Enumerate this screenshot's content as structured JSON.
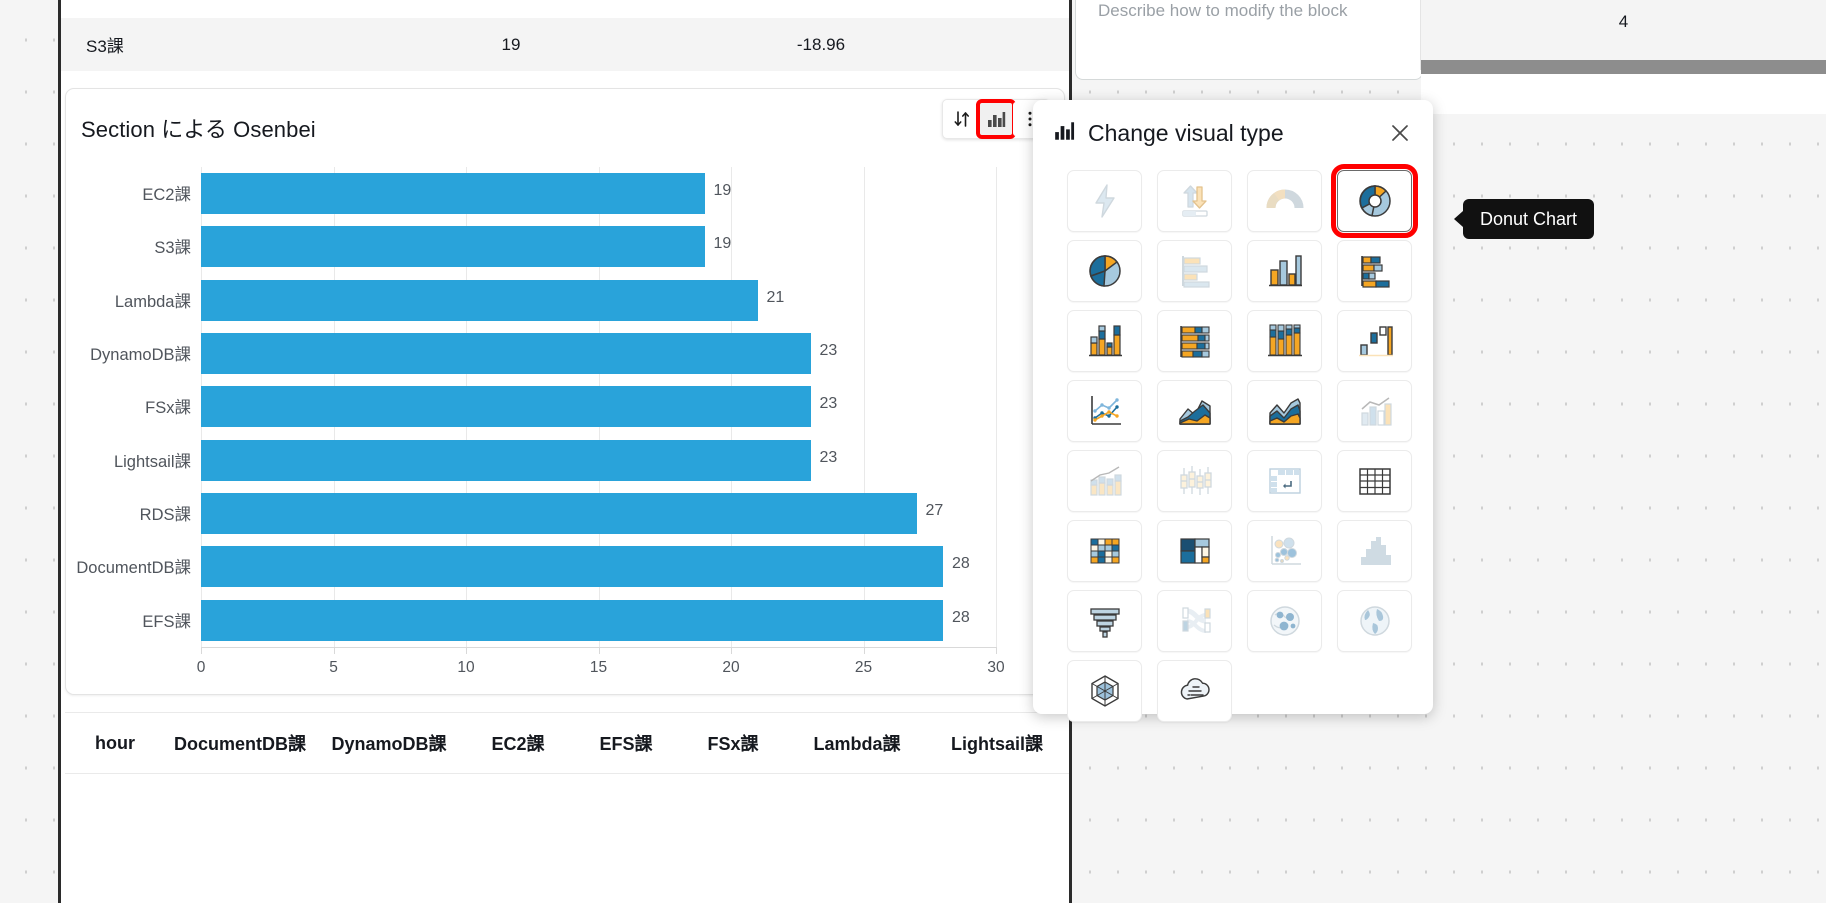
{
  "top_table": {
    "row": {
      "section": "S3課",
      "count": "19",
      "delta": "-18.96"
    }
  },
  "chart_card": {
    "title": "Section による Osenbei",
    "toolbar": {
      "sort_icon": "sort-icon",
      "visual_type_icon": "bar-chart-icon",
      "more_icon": "kebab-menu-icon"
    }
  },
  "chart_data": {
    "type": "bar",
    "orientation": "horizontal",
    "title": "Section による Osenbei",
    "xlabel": "",
    "ylabel": "",
    "categories": [
      "EC2課",
      "S3課",
      "Lambda課",
      "DynamoDB課",
      "FSx課",
      "Lightsail課",
      "RDS課",
      "DocumentDB課",
      "EFS課"
    ],
    "values": [
      19,
      19,
      21,
      23,
      23,
      23,
      27,
      28,
      28
    ],
    "value_labels": [
      "19",
      "19",
      "21",
      "23",
      "23",
      "23",
      "27",
      "28",
      "28"
    ],
    "xlim": [
      0,
      30
    ],
    "xticks": [
      "0",
      "5",
      "10",
      "15",
      "20",
      "25",
      "30"
    ],
    "xtick_values": [
      0,
      5,
      10,
      15,
      20,
      25,
      30
    ],
    "grid": true,
    "legend": false,
    "bar_color": "#29a3da"
  },
  "bottom_table": {
    "headers": [
      "hour",
      "DocumentDB課",
      "DynamoDB課",
      "EC2課",
      "EFS課",
      "FSx課",
      "Lambda課",
      "Lightsail課"
    ]
  },
  "right_panels": {
    "prompt_placeholder": "Describe how to modify the block",
    "metric_value": "4"
  },
  "change_visual_type": {
    "title": "Change visual type",
    "header_icon": "bar-chart-icon",
    "close_icon": "close-icon",
    "selected": "Donut Chart",
    "tooltip": "Donut Chart",
    "items": [
      {
        "name": "autograph-icon",
        "label": "AutoGraph"
      },
      {
        "name": "kpi-icon",
        "label": "KPI"
      },
      {
        "name": "gauge-chart-icon",
        "label": "Gauge Chart"
      },
      {
        "name": "donut-chart-icon",
        "label": "Donut Chart"
      },
      {
        "name": "pie-chart-icon",
        "label": "Pie Chart"
      },
      {
        "name": "horizontal-bar-chart-icon",
        "label": "Horizontal Bar Chart"
      },
      {
        "name": "vertical-bar-chart-icon",
        "label": "Vertical Bar Chart"
      },
      {
        "name": "horizontal-stacked-bar-chart-icon",
        "label": "Horizontal Stacked Bar Chart"
      },
      {
        "name": "vertical-stacked-bar-chart-icon",
        "label": "Vertical Stacked Bar Chart"
      },
      {
        "name": "horizontal-stacked-100-bar-chart-icon",
        "label": "Horizontal Stacked 100% Bar Chart"
      },
      {
        "name": "vertical-stacked-100-bar-chart-icon",
        "label": "Vertical Stacked 100% Bar Chart"
      },
      {
        "name": "waterfall-chart-icon",
        "label": "Waterfall Chart"
      },
      {
        "name": "line-chart-icon",
        "label": "Line Chart"
      },
      {
        "name": "area-line-chart-icon",
        "label": "Area Line Chart"
      },
      {
        "name": "stacked-area-line-chart-icon",
        "label": "Stacked Area Line Chart"
      },
      {
        "name": "clustered-combo-chart-icon",
        "label": "Clustered Combo Chart"
      },
      {
        "name": "stacked-combo-chart-icon",
        "label": "Stacked Combo Chart"
      },
      {
        "name": "box-plot-icon",
        "label": "Box Plot"
      },
      {
        "name": "pivot-table-icon",
        "label": "Pivot Table"
      },
      {
        "name": "table-icon",
        "label": "Table"
      },
      {
        "name": "heat-map-icon",
        "label": "Heat Map"
      },
      {
        "name": "tree-map-icon",
        "label": "Tree Map"
      },
      {
        "name": "scatter-plot-icon",
        "label": "Scatter Plot"
      },
      {
        "name": "histogram-icon",
        "label": "Histogram"
      },
      {
        "name": "funnel-chart-icon",
        "label": "Funnel Chart"
      },
      {
        "name": "sankey-diagram-icon",
        "label": "Sankey Diagram"
      },
      {
        "name": "points-on-map-icon",
        "label": "Points on Map"
      },
      {
        "name": "filled-map-icon",
        "label": "Filled Map"
      },
      {
        "name": "radar-chart-icon",
        "label": "Radar Chart"
      },
      {
        "name": "word-cloud-icon",
        "label": "Word Cloud"
      }
    ]
  },
  "colors": {
    "bar": "#29a3da",
    "selection": "#ff0000",
    "icon_blue": "#1c6e9c",
    "icon_lightblue": "#a6c9de",
    "icon_orange": "#f5a623"
  }
}
